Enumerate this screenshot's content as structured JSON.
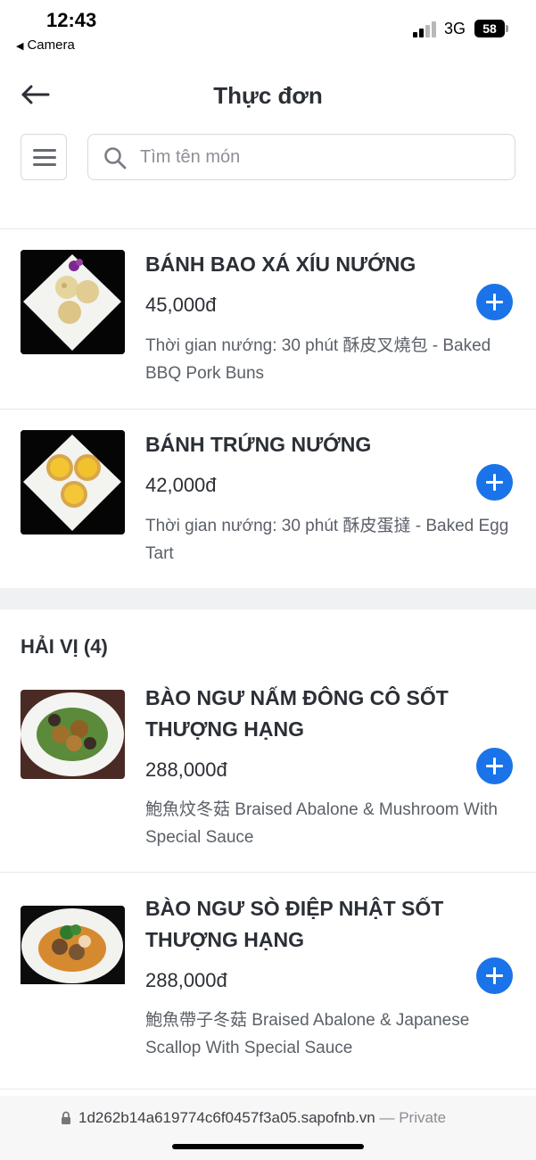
{
  "status_bar": {
    "time": "12:43",
    "back_app": "Camera",
    "network": "3G",
    "battery": "58"
  },
  "header": {
    "title": "Thực đơn",
    "back_icon": "arrow-left-icon"
  },
  "search": {
    "placeholder": "Tìm tên món",
    "value": "",
    "icon": "search-icon",
    "menu_icon": "hamburger-menu-icon"
  },
  "colors": {
    "accent": "#1a73e8",
    "text": "#2b2f36",
    "muted": "#5b6068",
    "divider": "#e6e8eb",
    "band": "#f0f1f3"
  },
  "items_top": [
    {
      "name": "BÁNH BAO XÁ XÍU NƯỚNG",
      "price": "45,000đ",
      "description": "Thời gian nướng: 30 phút 酥皮叉燒包 - Baked BBQ Pork Buns"
    },
    {
      "name": "BÁNH TRỨNG NƯỚNG",
      "price": "42,000đ",
      "description": "Thời gian nướng: 30 phút 酥皮蛋撻 - Baked Egg Tart"
    }
  ],
  "section": {
    "title": "HẢI VỊ (4)"
  },
  "items_seafood": [
    {
      "name": "BÀO NGƯ NẤM ĐÔNG CÔ SỐT THƯỢNG HẠNG",
      "price": "288,000đ",
      "description": "鮑魚炆冬菇 Braised Abalone & Mushroom With Special Sauce"
    },
    {
      "name": "BÀO NGƯ SÒ ĐIỆP NHẬT SỐT THƯỢNG HẠNG",
      "price": "288,000đ",
      "description": "鮑魚帶子冬菇 Braised Abalone & Japanese Scallop With Special Sauce"
    }
  ],
  "url_bar": {
    "url": "1d262b14a619774c6f0457f3a05.sapofnb.vn",
    "suffix": "— Private"
  }
}
